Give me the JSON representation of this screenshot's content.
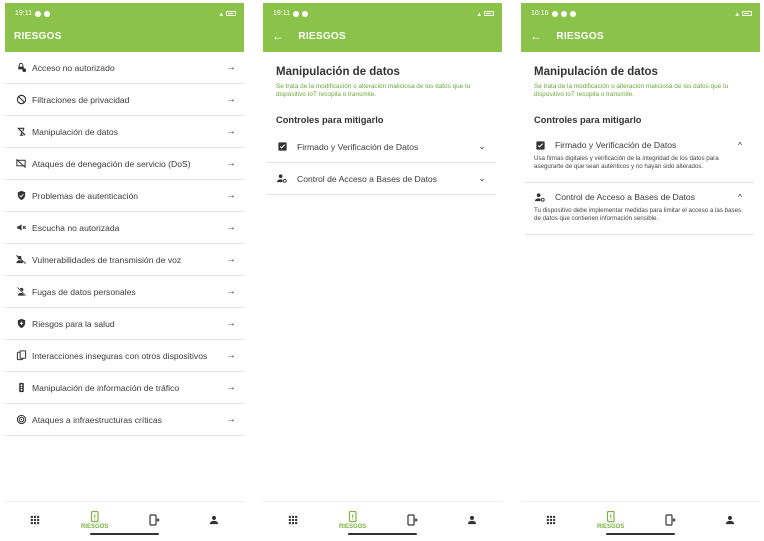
{
  "screens": [
    {
      "status": {
        "time": "19:11"
      },
      "appbar": {
        "title": "RIESGOS",
        "back": ""
      },
      "risks": [
        {
          "label": "Acceso no autorizado",
          "icon": "lock-person-icon"
        },
        {
          "label": "Filtraciones de privacidad",
          "icon": "privacy-block-icon"
        },
        {
          "label": "Manipulación de datos",
          "icon": "data-off-icon"
        },
        {
          "label": "Ataques de denegación de servicio (DoS)",
          "icon": "device-off-icon"
        },
        {
          "label": "Problemas de autenticación",
          "icon": "shield-check-icon"
        },
        {
          "label": "Escucha no autorizada",
          "icon": "volume-off-icon"
        },
        {
          "label": "Vulnerabilidades de transmisión de voz",
          "icon": "voice-off-icon"
        },
        {
          "label": "Fugas de datos personales",
          "icon": "person-off-icon"
        },
        {
          "label": "Riesgos para la salud",
          "icon": "health-shield-icon"
        },
        {
          "label": "Interacciones inseguras con otros dispositivos",
          "icon": "devices-icon"
        },
        {
          "label": "Manipulación de información de tráfico",
          "icon": "traffic-light-icon"
        },
        {
          "label": "Ataques a infraestructuras críticas",
          "icon": "target-icon"
        }
      ]
    },
    {
      "status": {
        "time": "19:11"
      },
      "appbar": {
        "title": "RIESGOS",
        "back": "←"
      },
      "detail": {
        "title": "Manipulación de datos",
        "description": "Se trata de la modificación o alteración maliciosa de los datos que tu dispositivo IoT recopila o transmite.",
        "controls_heading": "Controles para mitigarlo",
        "controls": [
          {
            "label": "Firmado y Verificación de Datos",
            "icon": "checkbox-icon",
            "expanded": false,
            "chevron": "⌄",
            "body": ""
          },
          {
            "label": "Control de Acceso a Bases de Datos",
            "icon": "person-gear-icon",
            "expanded": false,
            "chevron": "⌄",
            "body": ""
          }
        ]
      }
    },
    {
      "status": {
        "time": "10:16"
      },
      "appbar": {
        "title": "RIESGOS",
        "back": "←"
      },
      "detail": {
        "title": "Manipulación de datos",
        "description": "Se trata de la modificación o alteración maliciosa de los datos que tu dispositivo IoT recopila o transmite.",
        "controls_heading": "Controles para mitigarlo",
        "controls": [
          {
            "label": "Firmado y Verificación de Datos",
            "icon": "checkbox-icon",
            "expanded": true,
            "chevron": "^",
            "body": "Usa firmas digitales y verificación de la integridad de los datos para asegurarte de que sean auténticos y no hayan sido alterados."
          },
          {
            "label": "Control de Acceso a Bases de Datos",
            "icon": "person-gear-icon",
            "expanded": true,
            "chevron": "^",
            "body": "Tu dispositivo debe implementar medidas para limitar el acceso a las bases de datos que contienen información sensible."
          }
        ]
      }
    }
  ],
  "bottom_nav": [
    {
      "label": "",
      "icon": "grid-icon",
      "active": false
    },
    {
      "label": "RIESGOS",
      "icon": "device-alert-icon",
      "active": true
    },
    {
      "label": "",
      "icon": "device-share-icon",
      "active": false
    },
    {
      "label": "",
      "icon": "person-icon",
      "active": false
    }
  ],
  "colors": {
    "accent": "#8bc34a",
    "link_text": "#6aa83a",
    "active_nav": "#7cb342"
  },
  "row_arrow": "→"
}
